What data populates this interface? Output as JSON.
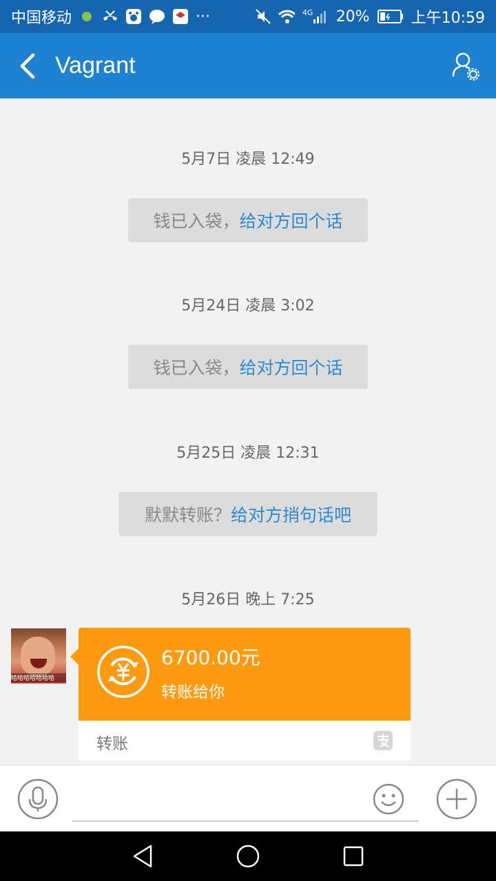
{
  "status_bar": {
    "carrier": "中国移动",
    "network": "4G",
    "battery": "20%",
    "time": "上午10:59",
    "icons": [
      "signal-dot-icon",
      "missed-call-icon",
      "baidu-icon",
      "chat-bubble-icon",
      "app-notification-icon",
      "more-dots-icon",
      "mute-icon",
      "wifi-icon",
      "cell-signal-icon",
      "battery-icon"
    ]
  },
  "app_bar": {
    "title": "Vagrant",
    "back_icon": "chevron-left-icon",
    "profile_icon": "user-settings-icon"
  },
  "messages": [
    {
      "timestamp": "5月7日 凌晨 12:49",
      "text": "钱已入袋，",
      "link": "给对方回个话"
    },
    {
      "timestamp": "5月24日 凌晨 3:02",
      "text": "钱已入袋，",
      "link": "给对方回个话"
    },
    {
      "timestamp": "5月25日 凌晨 12:31",
      "text": "默默转账？",
      "link": "给对方捎句话吧"
    }
  ],
  "transfer": {
    "timestamp": "5月26日 晚上 7:25",
    "amount": "6700.00元",
    "description": "转账给你",
    "footer_label": "转账",
    "avatar_caption": "哈哈哈哈哈哈哈",
    "accent_color": "#fe9a0f"
  },
  "input_bar": {
    "placeholder": "",
    "mic_icon": "microphone-icon",
    "emoji_icon": "smiley-icon",
    "plus_icon": "plus-circle-icon"
  },
  "nav_bar": {
    "icons": [
      "back-triangle-icon",
      "home-circle-icon",
      "recents-square-icon"
    ]
  },
  "colors": {
    "status_bar": "#1565b0",
    "app_bar": "#1e82d2",
    "link": "#2a8ad6",
    "background": "#f2f2f2"
  }
}
